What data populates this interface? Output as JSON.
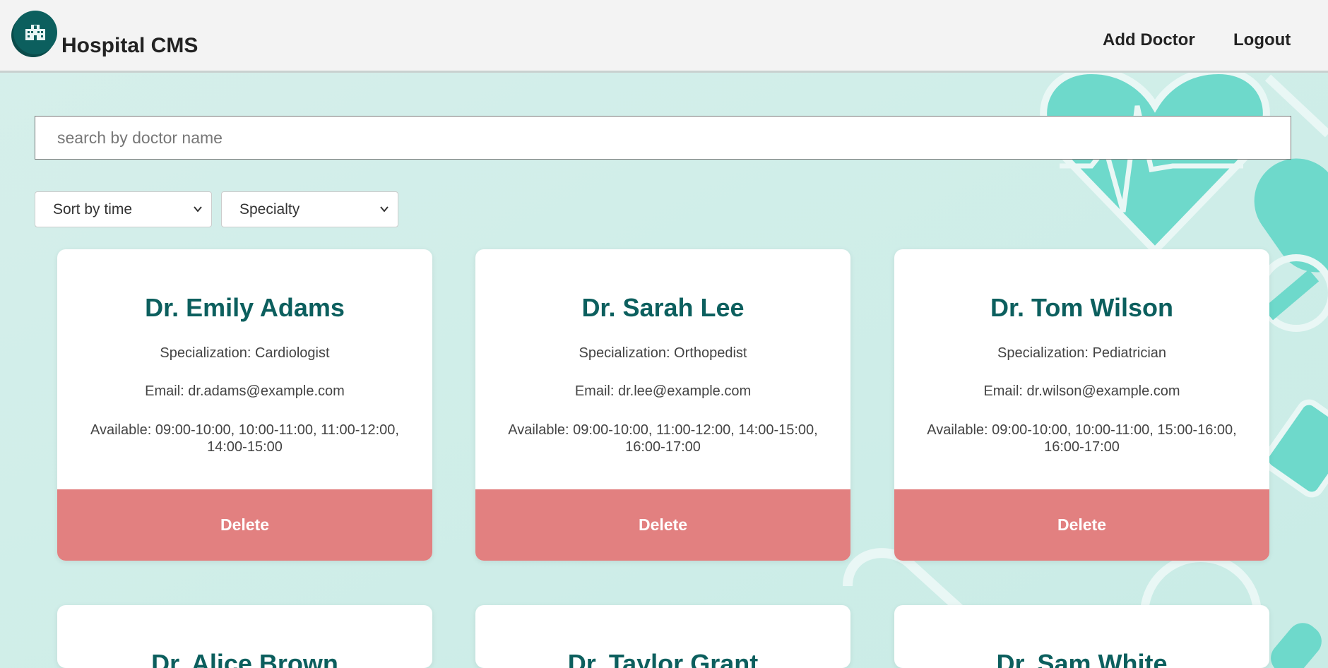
{
  "header": {
    "brand": "Hospital CMS",
    "logo_icon": "hospital-icon",
    "nav": [
      {
        "label": "Add Doctor"
      },
      {
        "label": "Logout"
      }
    ]
  },
  "search": {
    "placeholder": "search by doctor name",
    "value": ""
  },
  "filters": {
    "sort": {
      "selected": "Sort by time"
    },
    "specialty": {
      "selected": "Specialty"
    }
  },
  "colors": {
    "accent": "#0c5f5e",
    "delete": "#e28080",
    "background": "#d9f0ec"
  },
  "doctors": [
    {
      "name": "Dr. Emily Adams",
      "specialization": "Specialization: Cardiologist",
      "email": "Email: dr.adams@example.com",
      "available": "Available: 09:00-10:00, 10:00-11:00, 11:00-12:00, 14:00-15:00",
      "delete_label": "Delete"
    },
    {
      "name": "Dr. Sarah Lee",
      "specialization": "Specialization: Orthopedist",
      "email": "Email: dr.lee@example.com",
      "available": "Available: 09:00-10:00, 11:00-12:00, 14:00-15:00, 16:00-17:00",
      "delete_label": "Delete"
    },
    {
      "name": "Dr. Tom Wilson",
      "specialization": "Specialization: Pediatrician",
      "email": "Email: dr.wilson@example.com",
      "available": "Available: 09:00-10:00, 10:00-11:00, 15:00-16:00, 16:00-17:00",
      "delete_label": "Delete"
    },
    {
      "name": "Dr. Alice Brown"
    },
    {
      "name": "Dr. Taylor Grant"
    },
    {
      "name": "Dr. Sam White"
    }
  ]
}
